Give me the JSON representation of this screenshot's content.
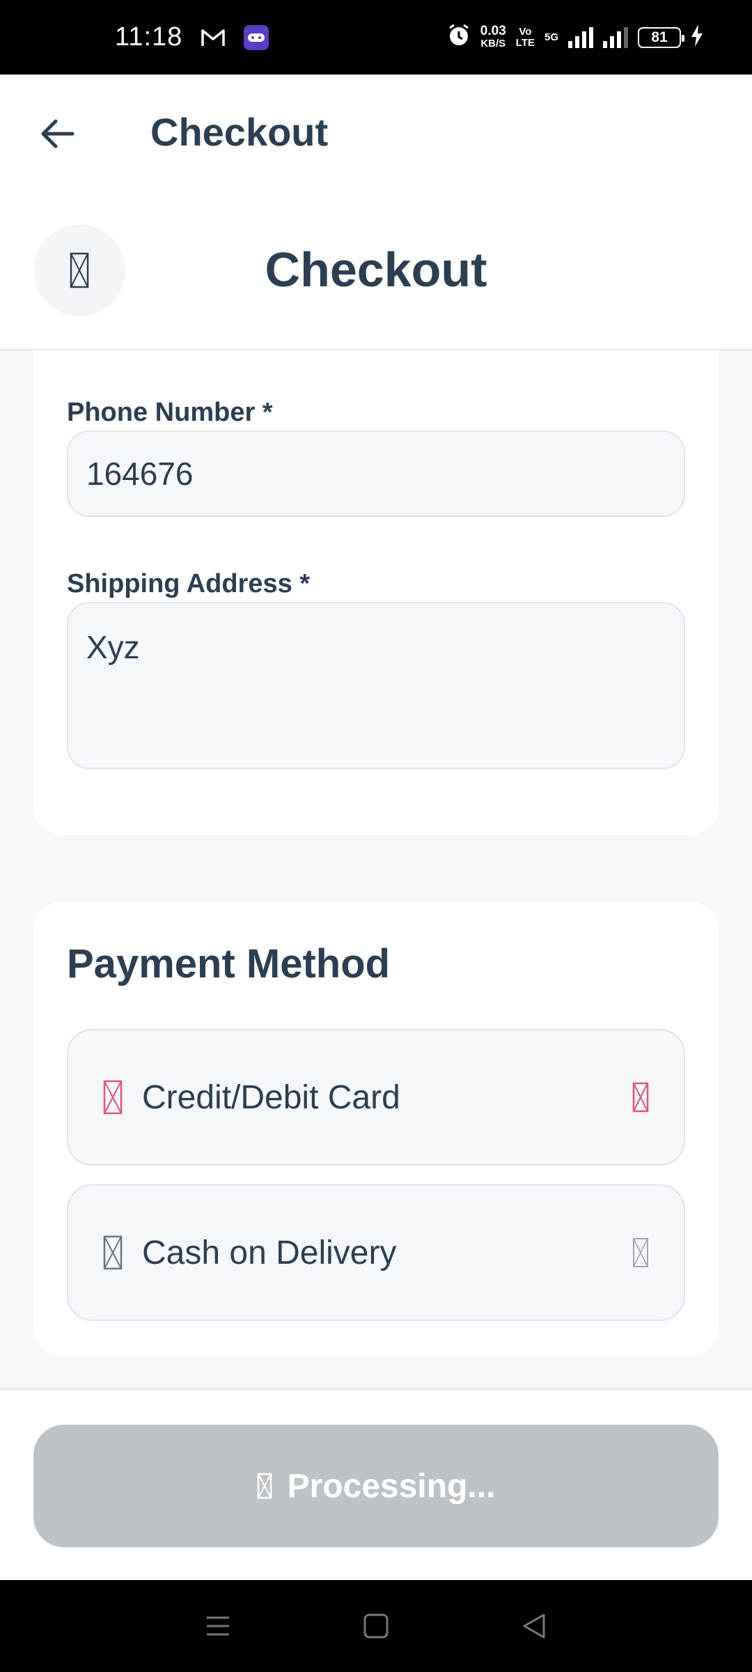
{
  "status_bar": {
    "time": "11:18",
    "speed_value": "0.03",
    "speed_unit": "KB/S",
    "volte_top": "Vo",
    "volte_bottom": "LTE",
    "network": "5G",
    "battery": "81"
  },
  "app_bar": {
    "title": "Checkout"
  },
  "page_header": {
    "title": "Checkout"
  },
  "shipping": {
    "phone_label": "Phone Number *",
    "phone_value": "164676",
    "address_label": "Shipping Address *",
    "address_value": "Xyz"
  },
  "payment": {
    "title": "Payment Method",
    "options": [
      {
        "label": "Credit/Debit Card",
        "selected": true,
        "color": "#e0567a"
      },
      {
        "label": "Cash on Delivery",
        "selected": false,
        "color": "#8a929b"
      }
    ]
  },
  "submit": {
    "label": "Processing..."
  },
  "colors": {
    "text": "#2c3e50",
    "background": "#f5f7fa",
    "button_disabled": "#bdc2c7",
    "accent": "#e0567a"
  }
}
